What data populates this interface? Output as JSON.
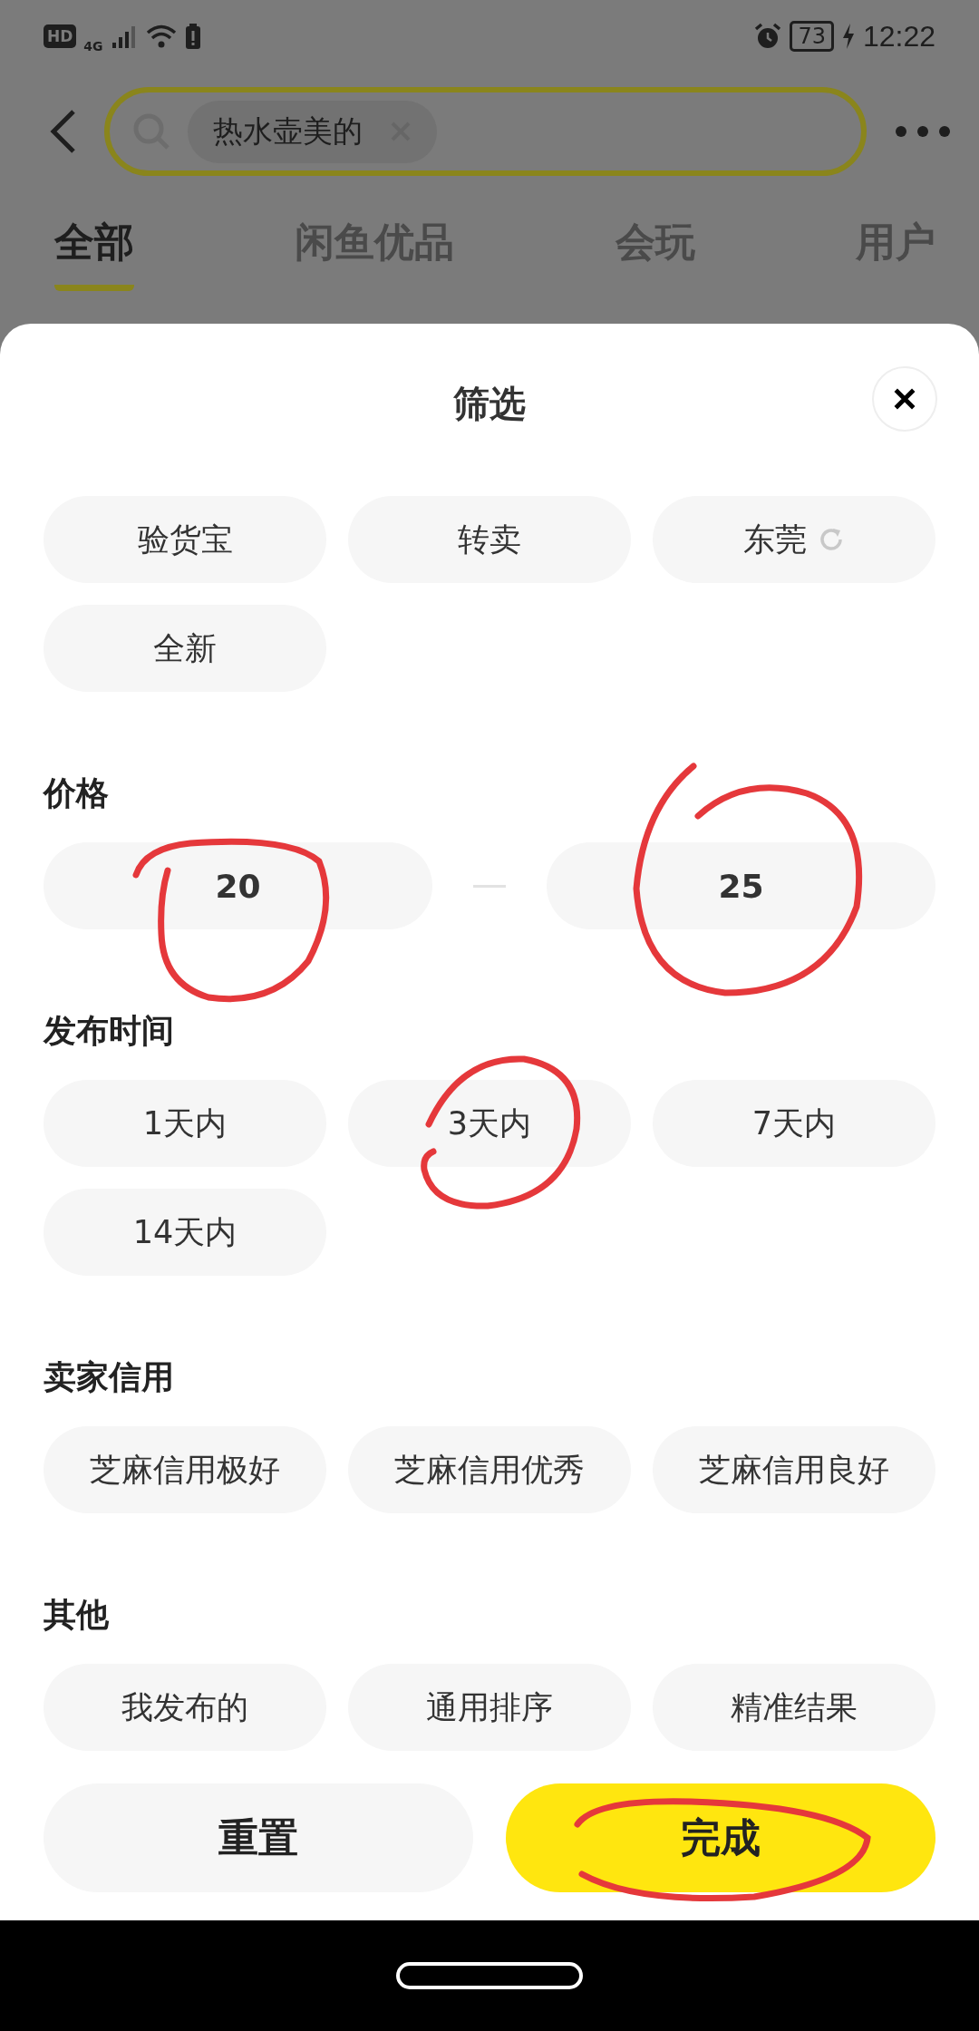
{
  "status_bar": {
    "network_badge": "HD",
    "network_type": "4G",
    "battery": "73",
    "time": "12:22"
  },
  "search": {
    "query_chip": "热水壶美的"
  },
  "tabs": [
    {
      "label": "全部",
      "selected": true
    },
    {
      "label": "闲鱼优品",
      "selected": false
    },
    {
      "label": "会玩",
      "selected": false
    },
    {
      "label": "用户",
      "selected": false
    }
  ],
  "filter_sheet": {
    "title": "筛选",
    "sections": [
      {
        "kind": "chips",
        "chips": [
          {
            "label": "验货宝",
            "selected": false,
            "refresh": false
          },
          {
            "label": "转卖",
            "selected": false,
            "refresh": false
          },
          {
            "label": "东莞",
            "selected": false,
            "refresh": true
          },
          {
            "label": "全新",
            "selected": false,
            "refresh": false
          }
        ]
      },
      {
        "kind": "range",
        "title": "价格",
        "min": "20",
        "max": "25"
      },
      {
        "kind": "chips",
        "title": "发布时间",
        "chips": [
          {
            "label": "1天内",
            "selected": false,
            "refresh": false
          },
          {
            "label": "3天内",
            "selected": false,
            "refresh": false
          },
          {
            "label": "7天内",
            "selected": false,
            "refresh": false
          },
          {
            "label": "14天内",
            "selected": false,
            "refresh": false
          }
        ]
      },
      {
        "kind": "chips",
        "title": "卖家信用",
        "chips": [
          {
            "label": "芝麻信用极好",
            "selected": false,
            "refresh": false
          },
          {
            "label": "芝麻信用优秀",
            "selected": false,
            "refresh": false
          },
          {
            "label": "芝麻信用良好",
            "selected": false,
            "refresh": false
          }
        ]
      },
      {
        "kind": "chips",
        "title": "其他",
        "chips": [
          {
            "label": "我发布的",
            "selected": false,
            "refresh": false
          },
          {
            "label": "通用排序",
            "selected": false,
            "refresh": false
          },
          {
            "label": "精准结果",
            "selected": false,
            "refresh": false
          }
        ]
      }
    ]
  },
  "footer": {
    "reset": "重置",
    "done": "完成"
  }
}
